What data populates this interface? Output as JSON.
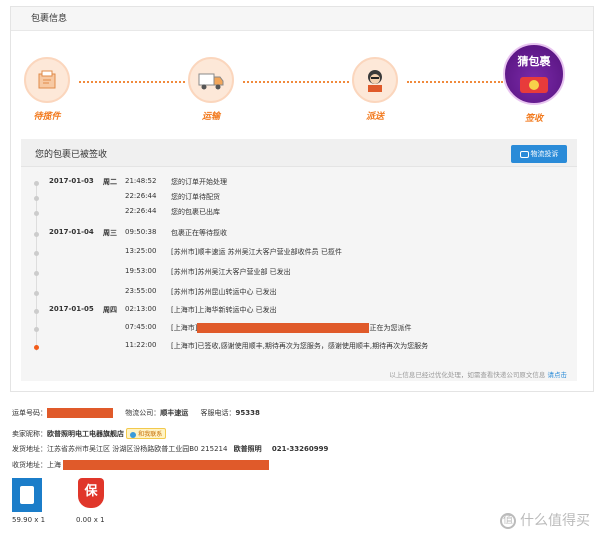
{
  "section_title": "包裹信息",
  "steps": [
    {
      "label": "待揽件",
      "icon": "package-icon"
    },
    {
      "label": "运输",
      "icon": "truck-icon"
    },
    {
      "label": "派送",
      "icon": "courier-icon"
    },
    {
      "label": "签收",
      "icon": "signed-badge-icon",
      "badge_text": "猜包裹"
    }
  ],
  "status": {
    "title": "您的包裹已被签收",
    "complaint_button": "物流投诉",
    "note": "以上信息已经过优化处理，如需查看快递公司原文信息",
    "note_link": "请点击"
  },
  "timeline": [
    {
      "date": "2017-01-03",
      "weekday": "周二",
      "time": "21:48:52",
      "desc": "您的订单开始处理"
    },
    {
      "date": "",
      "weekday": "",
      "time": "22:26:44",
      "desc": "您的订单待配货"
    },
    {
      "date": "",
      "weekday": "",
      "time": "22:26:44",
      "desc": "您的包裹已出库"
    },
    {
      "date": "2017-01-04",
      "weekday": "周三",
      "time": "09:50:38",
      "desc": "包裹正在等待揽收"
    },
    {
      "date": "",
      "weekday": "",
      "time": "13:25:00",
      "desc": "[苏州市]顺丰速运 苏州吴江大客户营业部收件员 已揽件"
    },
    {
      "date": "",
      "weekday": "",
      "time": "19:53:00",
      "desc": "[苏州市]苏州吴江大客户营业部 已发出"
    },
    {
      "date": "",
      "weekday": "",
      "time": "23:55:00",
      "desc": "[苏州市]苏州昆山转运中心 已发出"
    },
    {
      "date": "2017-01-05",
      "weekday": "周四",
      "time": "02:13:00",
      "desc": "[上海市]上海华新转运中心 已发出"
    },
    {
      "date": "",
      "weekday": "",
      "time": "07:45:00",
      "desc_prefix": "[上海市]",
      "desc_suffix": "正在为您派件"
    },
    {
      "date": "",
      "weekday": "",
      "time": "11:22:00",
      "desc": "[上海市]已签收,感谢使用顺丰,期待再次为您服务，感谢使用顺丰,期待再次为您服务"
    }
  ],
  "order": {
    "waybill_label": "运单号码：",
    "carrier_label": "物流公司：",
    "carrier": "顺丰速运",
    "phone_label": "客服电话：",
    "phone": "95338",
    "seller_label": "卖家昵称：",
    "seller": "欧普照明电工电器旗舰店",
    "contact_label": "和我联系",
    "ship_label": "发货地址：",
    "ship_address": "江苏省苏州市吴江区 汾湖区汾杨路欧普工业园B0 215214",
    "ship_brand": "欧普照明",
    "ship_phone": "021-33260999",
    "recv_label": "收货地址：",
    "recv_address": "上海"
  },
  "products": [
    {
      "price": "59.90 x 1"
    },
    {
      "price": "0.00 x 1",
      "badge": "保"
    }
  ],
  "watermark": "什么值得买",
  "colors": {
    "accent": "#f27a1e",
    "blue": "#2a8bd8",
    "redact": "#e05a2a"
  }
}
